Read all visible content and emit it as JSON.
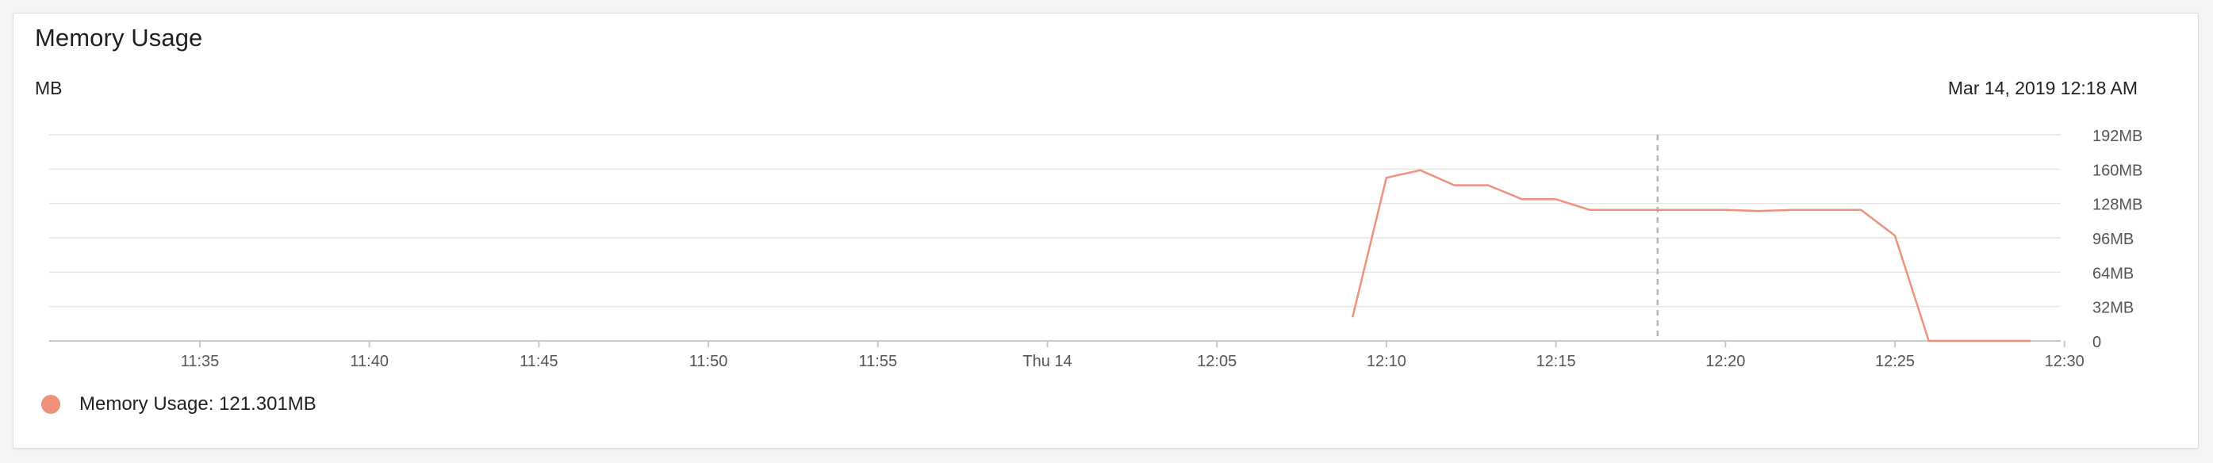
{
  "title": "Memory Usage",
  "unit_label": "MB",
  "timestamp": "Mar 14, 2019 12:18 AM",
  "legend": {
    "label": "Memory Usage: 121.301MB",
    "color": "#f0917c"
  },
  "chart_data": {
    "type": "line",
    "title": "Memory Usage",
    "ylabel": "MB",
    "x_ticks": [
      {
        "t": 0,
        "label": "11:35"
      },
      {
        "t": 5,
        "label": "11:40"
      },
      {
        "t": 10,
        "label": "11:45"
      },
      {
        "t": 15,
        "label": "11:50"
      },
      {
        "t": 20,
        "label": "11:55"
      },
      {
        "t": 25,
        "label": "Thu 14"
      },
      {
        "t": 30,
        "label": "12:05"
      },
      {
        "t": 35,
        "label": "12:10"
      },
      {
        "t": 40,
        "label": "12:15"
      },
      {
        "t": 45,
        "label": "12:20"
      },
      {
        "t": 50,
        "label": "12:25"
      },
      {
        "t": 55,
        "label": "12:30"
      }
    ],
    "y_ticks": [
      {
        "v": 0,
        "label": "0"
      },
      {
        "v": 32,
        "label": "32MB"
      },
      {
        "v": 64,
        "label": "64MB"
      },
      {
        "v": 96,
        "label": "96MB"
      },
      {
        "v": 128,
        "label": "128MB"
      },
      {
        "v": 160,
        "label": "160MB"
      },
      {
        "v": 192,
        "label": "192MB"
      }
    ],
    "xlim": [
      "11:30:35",
      "12:30:35"
    ],
    "ylim": [
      0,
      192
    ],
    "grid": true,
    "series": [
      {
        "color": "#f0917c",
        "x": [
          "12:09",
          "12:10",
          "12:11",
          "12:12",
          "12:13",
          "12:14",
          "12:15",
          "12:16",
          "12:17",
          "12:18",
          "12:19",
          "12:20",
          "12:21",
          "12:22",
          "12:23",
          "12:24",
          "12:25",
          "12:26",
          "12:27",
          "12:28",
          "12:29"
        ],
        "values": [
          22,
          152,
          159,
          145,
          145,
          132,
          132,
          122,
          122,
          122,
          122,
          122,
          121,
          122,
          122,
          122,
          98,
          0,
          0,
          0,
          0
        ]
      }
    ],
    "cursor_x": "12:18"
  }
}
